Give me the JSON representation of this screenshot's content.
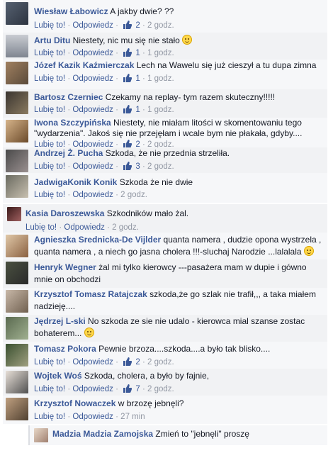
{
  "actions": {
    "like": "Lubię to!",
    "reply": "Odpowiedz",
    "sep": "·"
  },
  "comments": [
    {
      "author": "Wiesław Łabowicz",
      "text": "A jakby dwie? ??",
      "likes": "2",
      "time": "2 godz."
    },
    {
      "author": "Artu Ditu",
      "text": "Niestety, nic mu się nie stało",
      "emoji_icon": "smile-emoji-icon",
      "likes": "1",
      "time": "1 godz."
    },
    {
      "author": "Józef Kazik Kaźmierczak",
      "text": "Lech na Wawelu się już cieszył a tu dupa zimna",
      "likes": "1",
      "time": "1 godz."
    },
    {
      "author": "Bartosz Czerniec",
      "text": "Czekamy na replay- tym razem skuteczny!!!!!",
      "likes": "1",
      "time": "1 godz."
    },
    {
      "author": "Iwona Szczypińska",
      "text": "Niestety, nie miałam litości w skomentowaniu tego \"wydarzenia\". Jakoś się nie przejęłam i wcale bym nie płakała, gdyby....",
      "likes": "2",
      "time": "2 godz."
    },
    {
      "author": "Andrzej Ż. Pucha",
      "text": "Szkoda, że nie przednia strzeliła.",
      "likes": "3",
      "time": "2 godz."
    },
    {
      "author": "JadwigaKonik Konik",
      "text": "Szkoda że nie dwie",
      "time": "2 godz."
    },
    {
      "author": "Kasia Daroszewska",
      "text": "Szkodników mało żal.",
      "time": "2 godz."
    },
    {
      "author": "Agnieszka Srednicka-De Vijlder",
      "text": "quanta namera , dudzie opona wystrzela , quanta namera , a niech go jasna cholera !!!-sluchaj Narodzie ...lalalala",
      "emoji_icon": "smile-emoji-icon"
    },
    {
      "author": "Henryk Wegner",
      "text": "żal mi tylko kierowcy ---pasażera mam w dupie i gówno mnie on obchodzi"
    },
    {
      "author": "Krzysztof Tomasz Ratajczak",
      "text": "szkoda,że go szlak nie trafił,,, a taka miałem nadzieję...."
    },
    {
      "author": "Jędrzej L-ski",
      "text": "No szkoda ze sie nie udalo - kierowca mial szanse zostac bohaterem...",
      "emoji_icon": "smile-emoji-icon"
    },
    {
      "author": "Tomasz Pokora",
      "text": "Pewnie brzoza....szkoda....a było tak blisko....",
      "likes": "2",
      "time": "2 godz."
    },
    {
      "author": "Wojtek Woś",
      "text": "Szkoda, cholera, a było by fajnie,",
      "likes": "7",
      "time": "2 godz."
    },
    {
      "author": "Krzysztof Nowaczek",
      "text": "w brzozę jebnęli?",
      "time": "27 min"
    }
  ],
  "reply": {
    "author": "Madzia Madzia Zamojska",
    "text": "Zmień to \"jebnęli\" proszę"
  },
  "colors": {
    "link": "#3b5998",
    "meta": "#9197a3",
    "bg": "#f6f7f9"
  }
}
